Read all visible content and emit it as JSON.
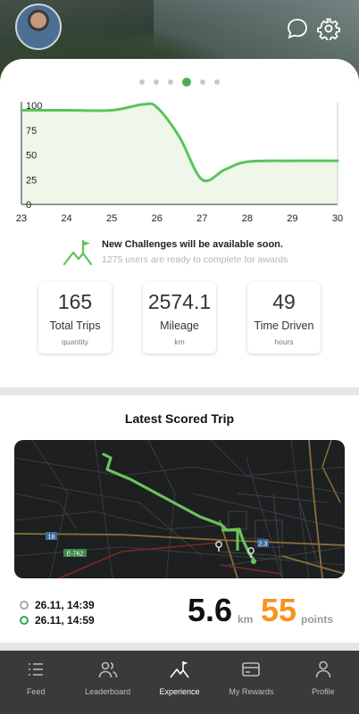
{
  "header": {
    "avatar_icon": "user-avatar",
    "chat_icon": "chat-bubble-icon",
    "settings_icon": "gear-icon"
  },
  "carousel": {
    "page_count": 6,
    "active_page": 4
  },
  "chart_data": {
    "type": "area",
    "x": [
      23,
      24,
      25,
      25.7,
      26,
      26.5,
      27,
      27.5,
      28,
      29,
      30
    ],
    "y": [
      95,
      95,
      95,
      101,
      98,
      68,
      25,
      35,
      43,
      44,
      44
    ],
    "xticks": [
      "23",
      "24",
      "25",
      "26",
      "27",
      "28",
      "29",
      "30"
    ],
    "yticks": [
      "100",
      "75",
      "50",
      "25",
      "0"
    ],
    "xlim": [
      23,
      30
    ],
    "ylim": [
      0,
      100
    ],
    "line_color": "#5cc35a",
    "fill_color": "#eef7ea",
    "grid": false
  },
  "challenge": {
    "icon": "mountain-flag-icon",
    "title": "New Challenges will be available soon.",
    "subtitle": "1275 users are ready to complete for awards"
  },
  "stats": [
    {
      "value": "165",
      "label": "Total Trips",
      "unit": "quantity"
    },
    {
      "value": "2574.1",
      "label": "Mileage",
      "unit": "km"
    },
    {
      "value": "49",
      "label": "Time Driven",
      "unit": "hours"
    }
  ],
  "trip": {
    "section_title": "Latest Scored Trip",
    "map_labels": {
      "road_1": "18",
      "road_2": "E-762",
      "road_3": "2.3"
    },
    "start_time": "26.11, 14:39",
    "end_time": "26.11, 14:59",
    "distance": "5.6",
    "distance_unit": "km",
    "points": "55",
    "points_unit": "points",
    "colors": {
      "route": "#6bc35a",
      "points": "#f7941d"
    }
  },
  "nav": [
    {
      "label": "Feed",
      "icon": "list-icon"
    },
    {
      "label": "Leaderboard",
      "icon": "users-icon"
    },
    {
      "label": "Experience",
      "icon": "mountain-flag-icon"
    },
    {
      "label": "My Rewards",
      "icon": "card-icon"
    },
    {
      "label": "Profile",
      "icon": "person-icon"
    }
  ],
  "nav_active": "Experience"
}
